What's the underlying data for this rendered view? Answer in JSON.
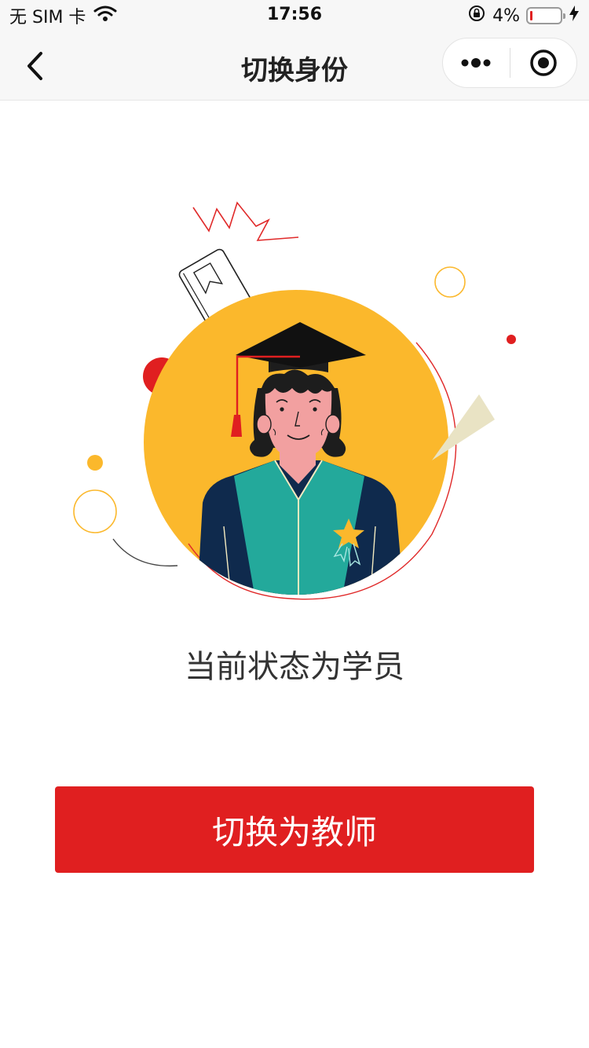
{
  "status_bar": {
    "carrier": "无 SIM 卡",
    "time": "17:56",
    "battery_percent": "4%",
    "battery_level": 0.04,
    "icons": [
      "wifi-icon",
      "rotation-lock-icon",
      "battery-icon",
      "charging-bolt-icon"
    ]
  },
  "nav": {
    "title": "切换身份",
    "icons": [
      "back-chevron-icon",
      "more-dots-icon",
      "close-target-icon"
    ]
  },
  "main": {
    "illustration": "graduate-student-illustration",
    "status_text": "当前状态为学员",
    "switch_button_label": "切换为教师"
  },
  "colors": {
    "accent_red": "#e01f20",
    "circle_yellow": "#fbb82c",
    "gown_teal": "#23a99b",
    "gown_navy": "#0f2a4d"
  }
}
